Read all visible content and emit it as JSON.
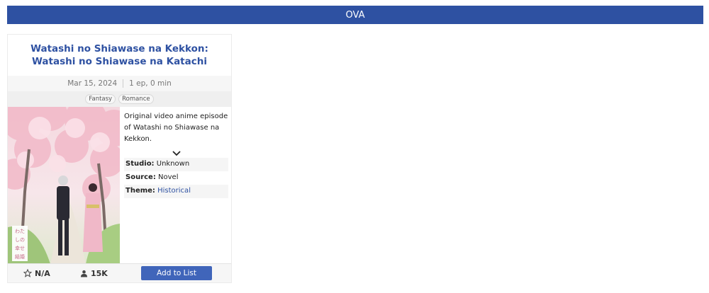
{
  "section": {
    "title": "OVA"
  },
  "card": {
    "title_line1": "Watashi no Shiawase na Kekkon:",
    "title_line2": "Watashi no Shiawase na Katachi",
    "date": "Mar 15, 2024",
    "episodes": "1 ep, 0 min",
    "genres": [
      "Fantasy",
      "Romance"
    ],
    "synopsis": "Original video anime episode of Watashi no Shiawase na Kekkon.",
    "properties": {
      "studio_label": "Studio:",
      "studio_value": "Unknown",
      "source_label": "Source:",
      "source_value": "Novel",
      "theme_label": "Theme:",
      "theme_value": "Historical"
    },
    "poster_text": "わたしの幸せな結婚",
    "score": "N/A",
    "members": "15K",
    "add_button_label": "Add to List"
  },
  "colors": {
    "header_bg": "#2e51a2",
    "title": "#2e51a2",
    "button_bg": "#4065ba"
  },
  "icons": {
    "score": "star-outline-icon",
    "members": "user-icon",
    "expand": "chevron-down-icon"
  }
}
